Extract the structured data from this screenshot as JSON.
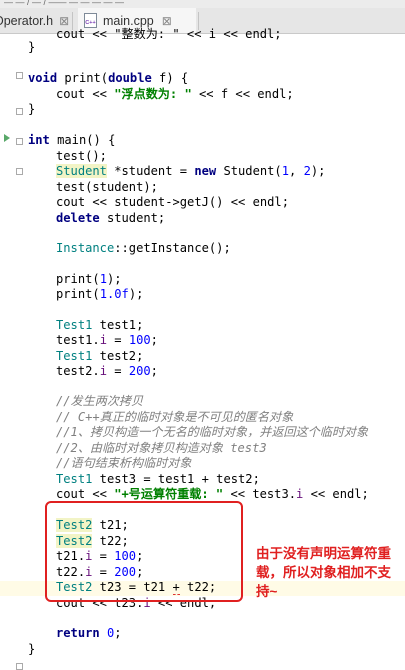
{
  "breadcrumb": {
    "text": "— —  /  —  / —— — — — — —"
  },
  "tabs": [
    {
      "label": "Operator.h",
      "active": false
    },
    {
      "label": "main.cpp",
      "active": true
    }
  ],
  "tab_close_glyph": "⊠",
  "file_icon_text": "C++",
  "annotation": "由于没有声明运算符重载，所以对象相加不支持~",
  "code": {
    "l0": "cout << \"整数为: \" << i << endl;",
    "l1": "}",
    "l3": [
      "void",
      " print(",
      "double",
      " f) {"
    ],
    "l4": [
      "cout << ",
      "\"浮点数为: \"",
      " << f << endl;"
    ],
    "l5": "}",
    "l7": [
      "int",
      " main() {"
    ],
    "l8": "test();",
    "l9": [
      "Student",
      " *student = ",
      "new",
      " Student(",
      "1",
      ", ",
      "2",
      ");"
    ],
    "l10": "test(student);",
    "l11": "cout << student->getJ() << endl;",
    "l12": [
      "delete",
      " student;"
    ],
    "l14": [
      "Instance",
      "::getInstance();"
    ],
    "l16": [
      "print(",
      "1",
      ");"
    ],
    "l17": [
      "print(",
      "1.0f",
      ");"
    ],
    "l19": [
      "Test1",
      " test1;"
    ],
    "l20": [
      "test1.",
      "i",
      " = ",
      "100",
      ";"
    ],
    "l21": [
      "Test1",
      " test2;"
    ],
    "l22": [
      "test2.",
      "i",
      " = ",
      "200",
      ";"
    ],
    "l24": "//发生两次拷贝",
    "l25": "// C++真正的临时对象是不可见的匿名对象",
    "l26": "//1、拷贝构造一个无名的临时对象，并返回这个临时对象",
    "l27": "//2、由临时对象拷贝构造对象 test3",
    "l28": "//语句结束析构临时对象",
    "l29": [
      "Test1",
      " test3 = test1 + test2;"
    ],
    "l30": [
      "cout << ",
      "\"+号运算符重载: \"",
      " << test3.",
      "i",
      " << endl;"
    ],
    "l32": [
      "Test2",
      " t21;"
    ],
    "l33": [
      "Test2",
      " t22;"
    ],
    "l34": [
      "t21.",
      "i",
      " = ",
      "100",
      ";"
    ],
    "l35": [
      "t22.",
      "i",
      " = ",
      "200",
      ";"
    ],
    "l36": [
      "Test2",
      " t23 = t21 ",
      "+",
      " t22;"
    ],
    "l37": [
      "cout << t23.",
      "i",
      " << endl;"
    ],
    "l39": [
      "return",
      " ",
      "0",
      ";"
    ],
    "l40": "}"
  }
}
